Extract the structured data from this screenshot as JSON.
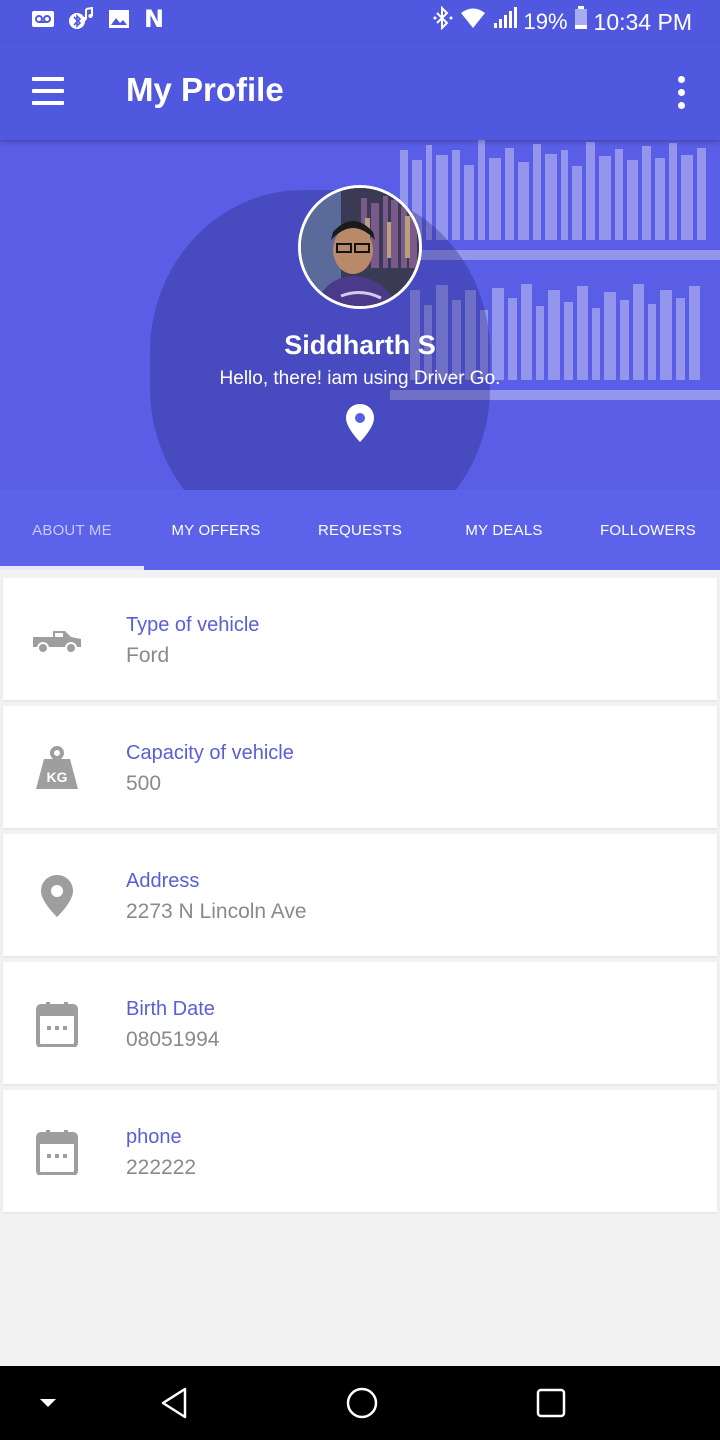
{
  "status_bar": {
    "left_icons": [
      "voicemail-icon",
      "bluetooth-music-icon",
      "image-icon"
    ],
    "n_icon_text": "N",
    "right_icons": [
      "bluetooth-icon",
      "wifi-icon",
      "signal-icon",
      "battery-icon"
    ],
    "battery": "19%",
    "time": "10:34 PM"
  },
  "app_bar": {
    "title": "My Profile",
    "menu_icon": "hamburger-menu-icon",
    "more_icon": "more-vert-icon",
    "background": "#5158e0"
  },
  "profile": {
    "name": "Siddharth S",
    "status": "Hello, there! iam using Driver Go.",
    "location_icon": "location-pin-icon"
  },
  "tabs": [
    {
      "label": "ABOUT ME",
      "active": true
    },
    {
      "label": "MY OFFERS",
      "active": false
    },
    {
      "label": "REQUESTS",
      "active": false
    },
    {
      "label": "MY DEALS",
      "active": false
    },
    {
      "label": "FOLLOWERS",
      "active": false
    }
  ],
  "details": [
    {
      "icon": "truck-icon",
      "label": "Type of vehicle",
      "value": "Ford"
    },
    {
      "icon": "weight-kg-icon",
      "label": "Capacity of vehicle",
      "value": "500"
    },
    {
      "icon": "location-pin-icon",
      "label": "Address",
      "value": "2273 N Lincoln Ave"
    },
    {
      "icon": "calendar-icon",
      "label": "Birth Date",
      "value": "08051994"
    },
    {
      "icon": "calendar-icon",
      "label": "phone",
      "value": "222222"
    }
  ],
  "colors": {
    "accent": "#5a5ed6",
    "tab_bar": "#5d62ea",
    "value_text": "#8a8a8a"
  },
  "nav_bar": {
    "items": [
      "dropdown-icon",
      "back-icon",
      "home-icon",
      "recents-icon"
    ]
  }
}
